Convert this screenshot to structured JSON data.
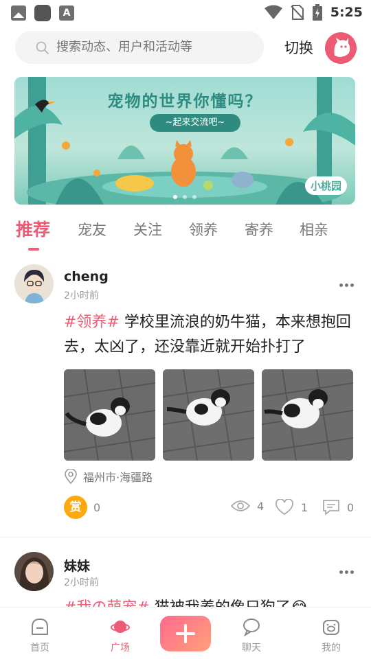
{
  "status_bar": {
    "time": "5:25",
    "left_icons": [
      "image-icon",
      "app-square-icon",
      "a-badge-icon"
    ],
    "right_icons": [
      "wifi-icon",
      "no-sim-icon",
      "battery-icon"
    ],
    "a_badge_letter": "A"
  },
  "header": {
    "search_placeholder": "搜索动态、用户和活动等",
    "switch_label": "切换"
  },
  "banner": {
    "title": "宠物的世界你懂吗？",
    "subtitle": "~起来交流吧~",
    "logo_text": "小桃园",
    "dots_count": 3,
    "active_dot": 0
  },
  "tabs": {
    "items": [
      {
        "label": "推荐",
        "active": true
      },
      {
        "label": "宠友",
        "active": false
      },
      {
        "label": "关注",
        "active": false
      },
      {
        "label": "领养",
        "active": false
      },
      {
        "label": "寄养",
        "active": false
      },
      {
        "label": "相亲",
        "active": false
      }
    ]
  },
  "posts": [
    {
      "username": "cheng",
      "time": "2小时前",
      "hashtag": "#领养#",
      "text": " 学校里流浪的奶牛猫，本来想抱回去，太凶了，还没靠近就开始扑打了",
      "location": "福州市·海疆路",
      "reward_label": "赏",
      "reward_count": "0",
      "views": "4",
      "likes": "1",
      "comments": "0"
    },
    {
      "username": "妹妹",
      "time": "2小时前",
      "hashtag": "#我の萌宠#",
      "text": " 猫被我养的像只狗了😂"
    }
  ],
  "bottom_nav": {
    "items": [
      {
        "label": "首页",
        "icon": "home-icon",
        "active": false
      },
      {
        "label": "广场",
        "icon": "planet-icon",
        "active": true
      },
      {
        "label": "聊天",
        "icon": "chat-icon",
        "active": false
      },
      {
        "label": "我的",
        "icon": "pig-face-icon",
        "active": false
      }
    ]
  },
  "colors": {
    "accent": "#ee5b76",
    "reward": "#fba90c",
    "text_secondary": "#9a9a9a"
  }
}
